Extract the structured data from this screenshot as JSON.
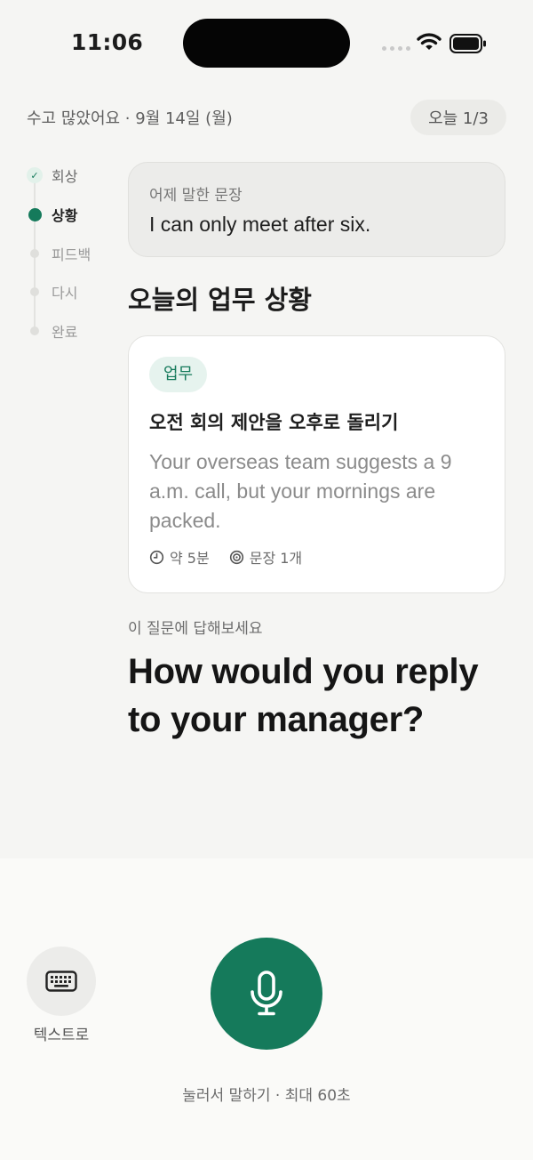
{
  "status_bar": {
    "time": "11:06"
  },
  "header": {
    "greeting": "수고 많았어요 · 9월 14일 (월)",
    "progress": "오늘 1/3"
  },
  "steps": [
    {
      "label": "회상",
      "state": "done"
    },
    {
      "label": "상황",
      "state": "active"
    },
    {
      "label": "피드백",
      "state": "pending"
    },
    {
      "label": "다시",
      "state": "pending"
    },
    {
      "label": "완료",
      "state": "pending"
    }
  ],
  "previous": {
    "label": "어제 말한 문장",
    "sentence": "I can only meet after six."
  },
  "section_title": "오늘의 업무 상황",
  "task": {
    "tag": "업무",
    "title": "오전 회의 제안을 오후로 돌리기",
    "description": "Your overseas team suggests a 9 a.m. call, but your mornings are packed.",
    "duration": "약 5분",
    "sentences": "문장 1개"
  },
  "question": {
    "hint": "이 질문에 답해보세요",
    "text": "How would you reply to your manager?"
  },
  "controls": {
    "text_mode_label": "텍스트로",
    "mic_hint": "눌러서 말하기 · 최대 60초"
  },
  "colors": {
    "accent": "#157a5b",
    "tag_bg": "#e6f3ee"
  },
  "icons": [
    "wifi-icon",
    "battery-icon",
    "check-icon",
    "clock-icon",
    "target-icon",
    "keyboard-icon",
    "microphone-icon"
  ]
}
